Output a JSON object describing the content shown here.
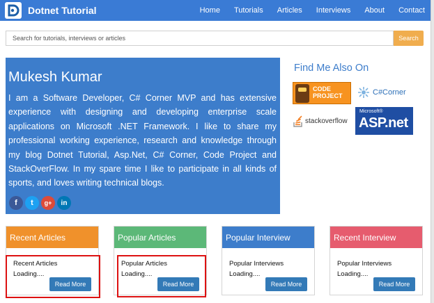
{
  "brand": {
    "name": "Dotnet Tutorial"
  },
  "nav": [
    "Home",
    "Tutorials",
    "Articles",
    "Interviews",
    "About",
    "Contact"
  ],
  "search": {
    "placeholder": "Search for tutorials, interviews or articles",
    "button": "Search"
  },
  "hero": {
    "name": "Mukesh Kumar",
    "bio": "I am a Software Developer, C# Corner MVP and has extensive experience with designing and developing enterprise scale applications on Microsoft .NET Framework. I like to share my professional working experience, research and knowledge through my blog Dotnet Tutorial, Asp.Net, C# Corner, Code Project and StackOverFlow. In my spare time I like to participate in all kinds of sports, and loves writing technical blogs.",
    "socials": [
      {
        "icon": "facebook-icon",
        "glyph": "f"
      },
      {
        "icon": "twitter-icon",
        "glyph": "t"
      },
      {
        "icon": "google-plus-icon",
        "glyph": "g+"
      },
      {
        "icon": "linkedin-icon",
        "glyph": "in"
      }
    ]
  },
  "find": {
    "title": "Find Me Also On",
    "codeproject": {
      "line1": "CODE",
      "line2": "PROJECT"
    },
    "csharpcorner": "C#Corner",
    "stackoverflow": "stackoverflow",
    "aspnet": {
      "small": "Microsoft®",
      "big": "ASP.net"
    }
  },
  "cards": [
    {
      "title": "Recent Articles",
      "body1": "Recent Articles",
      "body2": "Loading....",
      "button": "Read More",
      "color": "#f0912b"
    },
    {
      "title": "Popular Articles",
      "body1": "Popular Articles",
      "body2": "Loading....",
      "button": "Read More",
      "color": "#5cb878"
    },
    {
      "title": "Popular Interview",
      "body1": "Popular Interviews",
      "body2": "Loading....",
      "button": "Read More",
      "color": "#3d7dcb"
    },
    {
      "title": "Recent Interview",
      "body1": "Popular Interviews",
      "body2": "Loading....",
      "button": "Read More",
      "color": "#e65c6e"
    }
  ],
  "colors": {
    "navbar": "#3a7bd5",
    "hero": "#3d7dcb",
    "search_button": "#f0ad4e",
    "highlight": "#dd1111"
  }
}
